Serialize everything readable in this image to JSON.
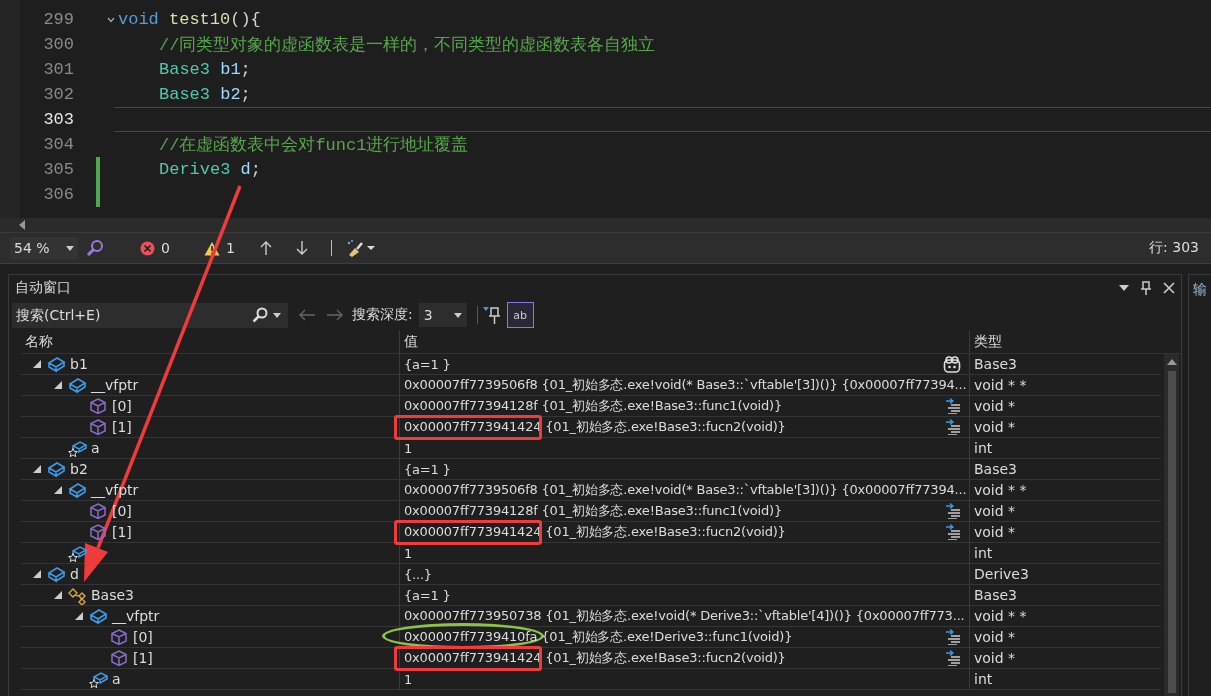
{
  "editor": {
    "lines": [
      {
        "number": "299",
        "foldable": true,
        "current": false,
        "changed": false,
        "tokens": [
          {
            "text": "void",
            "kind": "keyword"
          },
          {
            "text": "test10",
            "kind": "function",
            "space_before": true
          },
          {
            "text": "(){",
            "kind": "plain"
          }
        ],
        "children": [
          {
            "number": "300",
            "current": false,
            "changed": false,
            "tokens": [
              {
                "text": "//同类型对象的虚函数表是一样的，不同类型的虚函数表各自独立",
                "kind": "comment"
              }
            ]
          },
          {
            "number": "301",
            "current": false,
            "changed": false,
            "tokens": [
              {
                "text": "Base3",
                "kind": "type"
              },
              {
                "text": "b1",
                "kind": "variable",
                "space_before": true
              },
              {
                "text": ";",
                "kind": "plain"
              }
            ]
          },
          {
            "number": "302",
            "current": false,
            "changed": false,
            "tokens": [
              {
                "text": "Base3",
                "kind": "type"
              },
              {
                "text": "b2",
                "kind": "variable",
                "space_before": true
              },
              {
                "text": ";",
                "kind": "plain"
              }
            ]
          },
          {
            "number": "303",
            "current": true,
            "changed": false
          },
          {
            "number": "304",
            "current": false,
            "changed": false,
            "tokens": [
              {
                "text": "//在虚函数表中会对func1进行地址覆盖",
                "kind": "comment"
              }
            ]
          },
          {
            "number": "305",
            "current": false,
            "changed": true,
            "tokens": [
              {
                "text": "Derive3",
                "kind": "type"
              },
              {
                "text": "d",
                "kind": "variable",
                "space_before": true
              },
              {
                "text": ";",
                "kind": "plain"
              }
            ]
          },
          {
            "number": "306",
            "current": false,
            "changed": true
          }
        ]
      }
    ]
  },
  "status_bar": {
    "zoom": "54 %",
    "errors": "0",
    "warnings": "1",
    "position": "行: 303"
  },
  "autos": {
    "title": "自动窗口",
    "search": {
      "placeholder": "搜索(Ctrl+E)"
    },
    "depth_label": "搜索深度:",
    "depth": "3",
    "raw_toggle": {
      "label": "ab",
      "selected": true
    },
    "columns": [
      "名称",
      "值",
      "类型"
    ],
    "rows": [
      {
        "kind": "object",
        "name": "b1",
        "value": "{a=1 }",
        "type": "Base3",
        "visualizer_icon": true,
        "expanded": true,
        "children": [
          {
            "kind": "object",
            "name": "__vfptr",
            "value": "0x00007ff7739506f8 {01_初始多态.exe!void(* Base3::`vftable'[3])()} {0x00007ff77394...",
            "type": "void * *",
            "expanded": true,
            "children": [
              {
                "kind": "element",
                "name": "[0]",
                "value": "0x00007ff77394128f {01_初始多态.exe!Base3::func1(void)}",
                "type": "void *",
                "goto_icon": true
              },
              {
                "kind": "element",
                "name": "[1]",
                "value": "0x00007ff773941424 {01_初始多态.exe!Base3::fucn2(void)}",
                "type": "void *",
                "goto_icon": true,
                "boxed": true
              }
            ]
          },
          {
            "kind": "member",
            "name": "a",
            "value": "1",
            "type": "int"
          }
        ]
      },
      {
        "kind": "object",
        "name": "b2",
        "value": "{a=1 }",
        "type": "Base3",
        "expanded": true,
        "children": [
          {
            "kind": "object",
            "name": "__vfptr",
            "value": "0x00007ff7739506f8 {01_初始多态.exe!void(* Base3::`vftable'[3])()} {0x00007ff77394...",
            "type": "void * *",
            "expanded": true,
            "children": [
              {
                "kind": "element",
                "name": "[0]",
                "value": "0x00007ff77394128f {01_初始多态.exe!Base3::func1(void)}",
                "type": "void *",
                "goto_icon": true
              },
              {
                "kind": "element",
                "name": "[1]",
                "value": "0x00007ff773941424 {01_初始多态.exe!Base3::fucn2(void)}",
                "type": "void *",
                "goto_icon": true,
                "boxed": true
              }
            ]
          },
          {
            "kind": "member",
            "value": "1",
            "type": "int"
          }
        ]
      },
      {
        "kind": "object",
        "name": "d",
        "value": "{...}",
        "type": "Derive3",
        "expanded": true,
        "children": [
          {
            "kind": "base",
            "name": "Base3",
            "value": "{a=1 }",
            "type": "Base3",
            "expanded": true,
            "children": [
              {
                "kind": "object",
                "name": "__vfptr",
                "value": "0x00007ff773950738 {01_初始多态.exe!void(* Derive3::`vftable'[4])()} {0x00007ff773...",
                "type": "void * *",
                "expanded": true,
                "children": [
                  {
                    "kind": "element",
                    "name": "[0]",
                    "value": "0x00007ff7739410fa {01_初始多态.exe!Derive3::func1(void)}",
                    "type": "void *",
                    "goto_icon": true,
                    "circled": true
                  },
                  {
                    "kind": "element",
                    "name": "[1]",
                    "value": "0x00007ff773941424 {01_初始多态.exe!Base3::fucn2(void)}",
                    "type": "void *",
                    "goto_icon": true,
                    "boxed": true
                  }
                ]
              },
              {
                "kind": "member",
                "name": "a",
                "value": "1",
                "type": "int"
              }
            ]
          }
        ]
      }
    ]
  },
  "side_panel": {
    "title": "输"
  }
}
